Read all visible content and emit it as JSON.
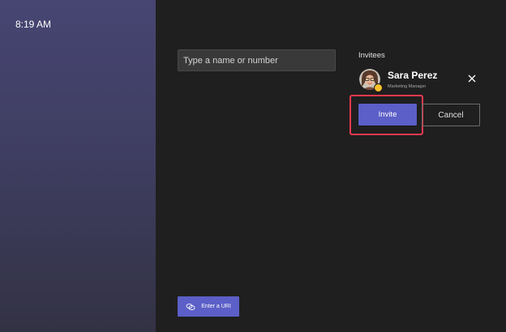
{
  "sidebar": {
    "clock": "8:19 AM"
  },
  "search": {
    "placeholder": "Type a name or number",
    "value": ""
  },
  "invitees": {
    "label": "Invitees",
    "items": [
      {
        "name": "Sara Perez",
        "title": "Marketing Manager",
        "status": "away",
        "status_color": "#f8c12a",
        "remove_icon": "close-icon"
      }
    ]
  },
  "actions": {
    "invite_label": "Invite",
    "cancel_label": "Cancel",
    "highlight_color": "#e8394f"
  },
  "footer": {
    "enter_uri_label": "Enter a URI",
    "enter_uri_icon": "link-icon"
  },
  "colors": {
    "accent": "#5b5fc7",
    "background": "#201f1f",
    "sidebar": "#474572"
  }
}
